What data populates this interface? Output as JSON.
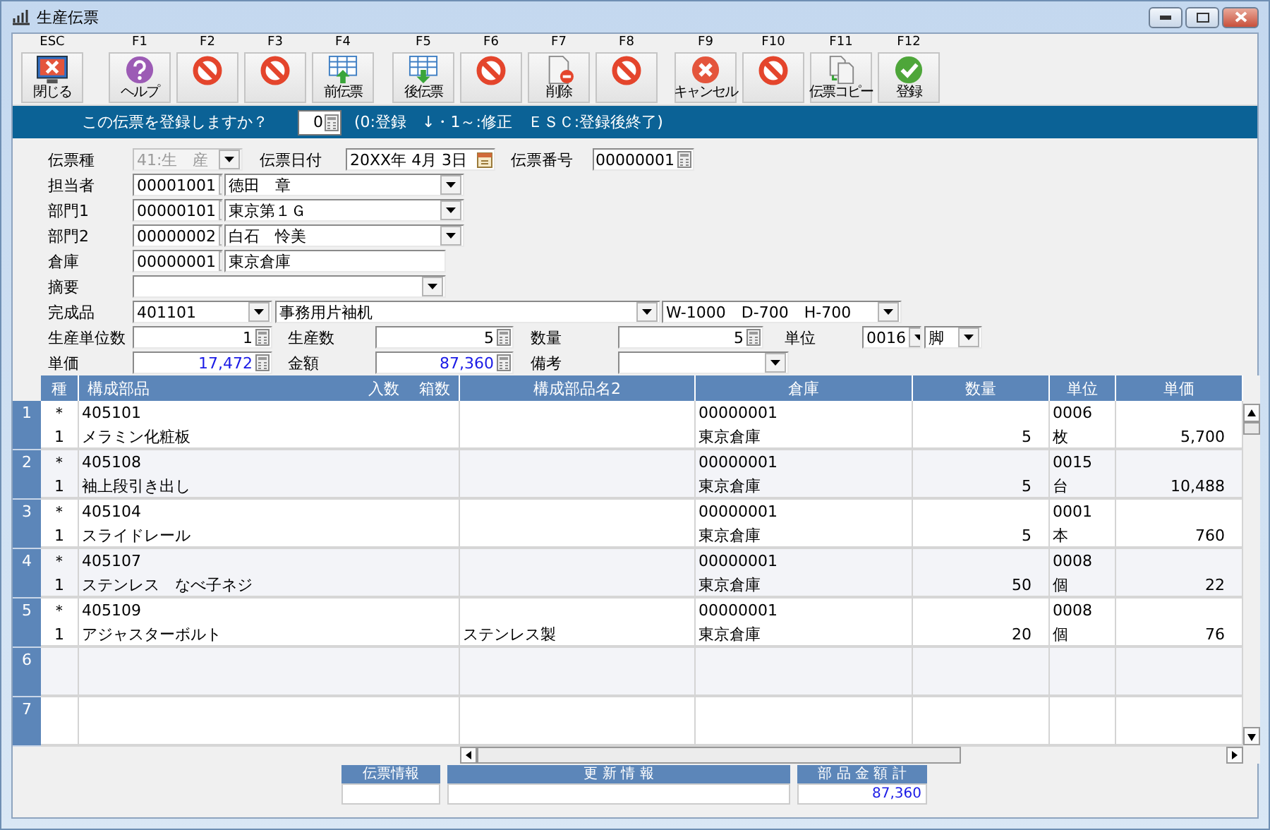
{
  "window": {
    "title": "生産伝票"
  },
  "toolbar": [
    {
      "key": "ESC",
      "label": "閉じる",
      "kind": "close"
    },
    {
      "key": "F1",
      "label": "ヘルプ",
      "kind": "help"
    },
    {
      "key": "F2",
      "kind": "prohibit"
    },
    {
      "key": "F3",
      "kind": "prohibit"
    },
    {
      "key": "F4",
      "label": "前伝票",
      "kind": "prev"
    },
    {
      "key": "F5",
      "label": "後伝票",
      "kind": "next"
    },
    {
      "key": "F6",
      "kind": "prohibit"
    },
    {
      "key": "F7",
      "label": "削除",
      "kind": "delete"
    },
    {
      "key": "F8",
      "kind": "prohibit"
    },
    {
      "key": "F9",
      "label": "キャンセル",
      "kind": "cancel"
    },
    {
      "key": "F10",
      "kind": "prohibit"
    },
    {
      "key": "F11",
      "label": "伝票コピー",
      "kind": "copy"
    },
    {
      "key": "F12",
      "label": "登録",
      "kind": "register"
    }
  ],
  "prompt": {
    "question": "この伝票を登録しますか？",
    "value": "0",
    "hint": "(0:登録　↓・1～:修正　ＥＳＣ:登録後終了)"
  },
  "form": [
    {
      "label": "伝票種",
      "fields": [
        {
          "kind": "combo",
          "value": "41:生　産",
          "disabled": true
        },
        {
          "kind": "label",
          "text": "伝票日付"
        },
        {
          "kind": "date",
          "value": "20XX年 4月 3日",
          "disabled": false
        },
        {
          "kind": "label",
          "text": "伝票番号"
        },
        {
          "kind": "number",
          "value": "00000001",
          "disabled": false
        }
      ]
    },
    {
      "label": "担当者",
      "fields": [
        {
          "kind": "combo",
          "value": "00001001",
          "disabled": false
        },
        {
          "kind": "combo",
          "value": "徳田　章",
          "disabled": false
        }
      ]
    },
    {
      "label": "部門1",
      "fields": [
        {
          "kind": "combo",
          "value": "00000101",
          "disabled": false
        },
        {
          "kind": "combo",
          "value": "東京第１Ｇ",
          "disabled": false
        }
      ]
    },
    {
      "label": "部門2",
      "fields": [
        {
          "kind": "combo",
          "value": "00000002",
          "disabled": false
        },
        {
          "kind": "combo",
          "value": "白石　怜美",
          "disabled": false
        }
      ]
    },
    {
      "label": "倉庫",
      "fields": [
        {
          "kind": "combo",
          "value": "00000001",
          "disabled": false
        },
        {
          "kind": "text",
          "value": "東京倉庫",
          "disabled": false
        }
      ]
    },
    {
      "label": "摘要",
      "fields": [
        {
          "kind": "combo",
          "disabled": false
        }
      ]
    },
    {
      "label": "完成品",
      "fields": [
        {
          "kind": "combo",
          "value": "401101",
          "disabled": false
        },
        {
          "kind": "combo",
          "value": "事務用片袖机",
          "disabled": false
        },
        {
          "kind": "combo",
          "value": "W-1000　D-700　H-700",
          "disabled": false
        }
      ]
    },
    {
      "label": "生産単位数",
      "fields": [
        {
          "kind": "number",
          "value": "1",
          "disabled": false
        },
        {
          "kind": "label",
          "text": "生産数"
        },
        {
          "kind": "number",
          "value": "5",
          "disabled": false
        },
        {
          "kind": "label",
          "text": "数量"
        },
        {
          "kind": "number",
          "value": "5",
          "disabled": false
        },
        {
          "kind": "label",
          "text": "単位"
        },
        {
          "kind": "combo",
          "value": "0016",
          "disabled": false
        },
        {
          "kind": "combo",
          "value": "脚",
          "disabled": false
        }
      ]
    },
    {
      "label": "単価",
      "fields": [
        {
          "kind": "number",
          "value": "17,472",
          "disabled": false,
          "highlight": true
        },
        {
          "kind": "label",
          "text": "金額"
        },
        {
          "kind": "number",
          "value": "87,360",
          "disabled": false,
          "highlight": true
        },
        {
          "kind": "label",
          "text": "備考"
        },
        {
          "kind": "combo",
          "disabled": false
        }
      ]
    }
  ],
  "table": {
    "columns": [
      {
        "label": "種"
      },
      {
        "label": "構成部品",
        "sub_labels": [
          "入数",
          "箱数"
        ]
      },
      {
        "label": "構成部品名2"
      },
      {
        "label": "倉庫"
      },
      {
        "label": "数量"
      },
      {
        "label": "単位"
      },
      {
        "label": "単価"
      }
    ],
    "rows": [
      {
        "number": "1",
        "mark": "＊",
        "type": "1",
        "code": "405101",
        "name": "メラミン化粧板",
        "warehouse_code": "00000001",
        "warehouse": "東京倉庫",
        "quantity": "5",
        "unit_code": "0006",
        "unit": "枚",
        "price": "5,700"
      },
      {
        "number": "2",
        "mark": "＊",
        "type": "1",
        "code": "405108",
        "name": "袖上段引き出し",
        "warehouse_code": "00000001",
        "warehouse": "東京倉庫",
        "quantity": "5",
        "unit_code": "0015",
        "unit": "台",
        "price": "10,488"
      },
      {
        "number": "3",
        "mark": "＊",
        "type": "1",
        "code": "405104",
        "name": "スライドレール",
        "warehouse_code": "00000001",
        "warehouse": "東京倉庫",
        "quantity": "5",
        "unit_code": "0001",
        "unit": "本",
        "price": "760"
      },
      {
        "number": "4",
        "mark": "＊",
        "type": "1",
        "code": "405107",
        "name": "ステンレス　なべ子ネジ",
        "warehouse_code": "00000001",
        "warehouse": "東京倉庫",
        "quantity": "50",
        "unit_code": "0008",
        "unit": "個",
        "price": "22"
      },
      {
        "number": "5",
        "mark": "＊",
        "type": "1",
        "code": "405109",
        "name": "アジャスターボルト",
        "name2": "ステンレス製",
        "warehouse_code": "00000001",
        "warehouse": "東京倉庫",
        "quantity": "20",
        "unit_code": "0008",
        "unit": "個",
        "price": "76"
      },
      {
        "number": "6"
      },
      {
        "number": "7"
      }
    ]
  },
  "summary": [
    {
      "title": "伝票情報"
    },
    {
      "title": "更 新 情 報"
    },
    {
      "title": "部 品 金 額 計",
      "value": "87,360"
    }
  ]
}
